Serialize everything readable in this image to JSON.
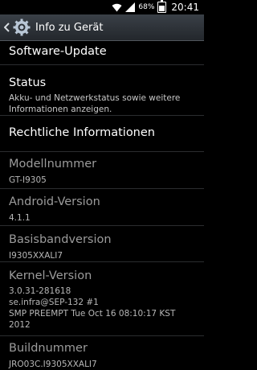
{
  "status_bar": {
    "battery_percent": "68%",
    "battery_level": 0.68,
    "time": "20:41",
    "icons": [
      "wifi-icon",
      "signal-icon",
      "battery-icon"
    ]
  },
  "action_bar": {
    "title": "Info zu Gerät",
    "icons": [
      "back-arrow-icon",
      "settings-gear-icon"
    ]
  },
  "items": {
    "software_update": {
      "title": "Software-Update"
    },
    "status": {
      "title": "Status",
      "summary": "Akku- und Netzwerkstatus sowie weitere Informationen anzeigen."
    },
    "legal": {
      "title": "Rechtliche Informationen"
    },
    "model": {
      "title": "Modellnummer",
      "value": "GT-I9305"
    },
    "android": {
      "title": "Android-Version",
      "value": "4.1.1"
    },
    "baseband": {
      "title": "Basisbandversion",
      "value": "I9305XXALI7"
    },
    "kernel": {
      "title": "Kernel-Version",
      "line1": "3.0.31-281618",
      "line2": "se.infra@SEP-132 #1",
      "line3": "SMP PREEMPT Tue Oct 16 08:10:17 KST",
      "line4": "2012"
    },
    "build": {
      "title": "Buildnummer",
      "value": "JRO03C.I9305XXALI7"
    }
  },
  "colors": {
    "background": "#000000",
    "action_bar": "#2b3036",
    "primary_text": "#ffffff",
    "secondary_text": "#9b9b9b",
    "divider": "#2b2d2f"
  }
}
